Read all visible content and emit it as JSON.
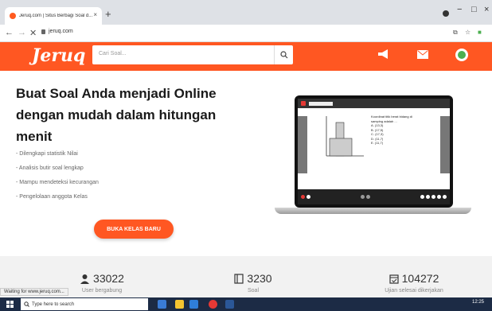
{
  "browser": {
    "tab_title": "Jeruq.com | Situs Berbagi Soal d...",
    "tab_close": "×",
    "new_tab": "+",
    "url": "jeruq.com",
    "minimize": "−",
    "maximize": "□",
    "close": "×"
  },
  "header": {
    "logo": "Jeruq",
    "search_placeholder": "Cari Soal..."
  },
  "hero": {
    "title": "Buat Soal Anda menjadi Online dengan mudah dalam hitungan menit",
    "features": [
      "- Dilengkapi statistik Nilai",
      "- Analisis butir soal lengkap",
      "- Mampu mendeteksi kecurangan",
      "- Pengelolaan anggota Kelas"
    ],
    "cta": "BUKA KELAS BARU"
  },
  "laptop": {
    "question": "Koordinat titik berat bidang di samping adalah ...",
    "options": [
      "A. (13,3)",
      "B. (17,5)",
      "C. (17,3)",
      "D. (11,7)",
      "E. (11,7)"
    ]
  },
  "stats": [
    {
      "num": "33022",
      "label": "User bergabung",
      "icon": "user-icon"
    },
    {
      "num": "3230",
      "label": "Soal",
      "icon": "book-icon"
    },
    {
      "num": "104272",
      "label": "Ujian selesai dikerjakan",
      "icon": "calendar-icon"
    }
  ],
  "status_tip": "Waiting for www.jeruq.com...",
  "taskbar": {
    "search_placeholder": "Type here to search",
    "time": "12:25"
  },
  "colors": {
    "accent": "#ff5722"
  }
}
